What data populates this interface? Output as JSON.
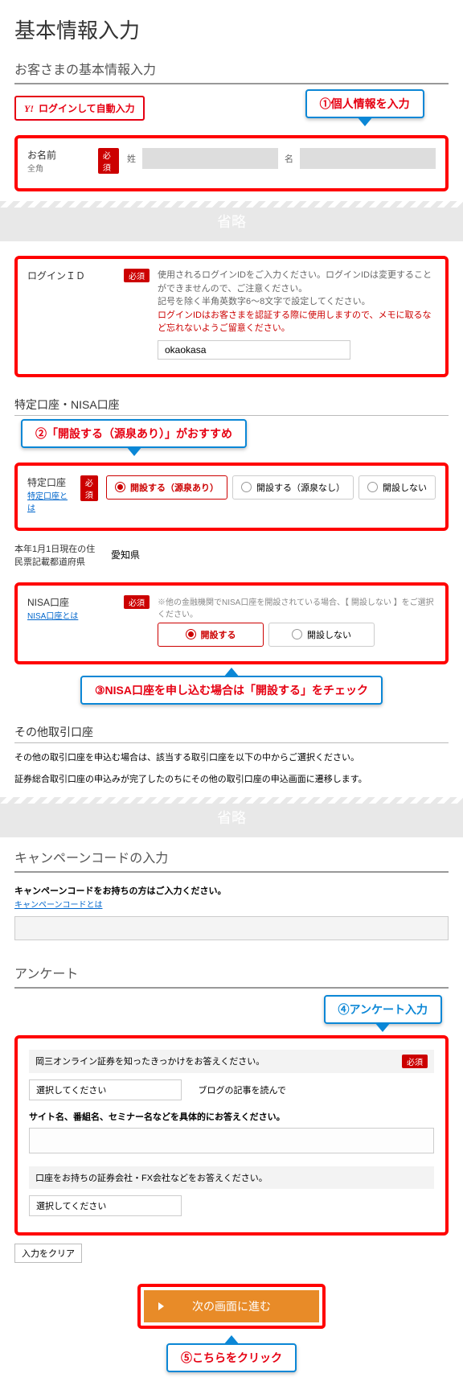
{
  "page_title": "基本情報入力",
  "section_basic": "お客さまの基本情報入力",
  "yahoo_btn": "ログインして自動入力",
  "callouts": {
    "c1": "①個人情報を入力",
    "c2": "②「開設する（源泉あり）」がおすすめ",
    "c3": "③NISA口座を申し込む場合は「開設する」をチェック",
    "c4": "④アンケート入力",
    "c5": "⑤こちらをクリック"
  },
  "required": "必須",
  "name": {
    "label": "お名前",
    "sub": "全角",
    "sei": "姓",
    "mei": "名"
  },
  "omitted": "省略",
  "login_id": {
    "label": "ログインＩＤ",
    "desc1": "使用されるログインIDをご入力ください。ログインIDは変更することができませんので、ご注意ください。",
    "desc2": "記号を除く半角英数字6～8文字で設定してください。",
    "warn": "ログインIDはお客さまを認証する際に使用しますので、メモに取るなど忘れないようご留意ください。",
    "value": "okaokasa"
  },
  "section_tokutei": "特定口座・NISA口座",
  "tokutei": {
    "label": "特定口座",
    "link": "特定口座とは",
    "opt1": "開設する（源泉あり）",
    "opt2": "開設する（源泉なし）",
    "opt3": "開設しない"
  },
  "pref": {
    "label": "本年1月1日現在の住民票記載都道府県",
    "value": "愛知県"
  },
  "nisa": {
    "label": "NISA口座",
    "link": "NISA口座とは",
    "note": "※他の金融機関でNISA口座を開設されている場合、【 開設しない 】をご選択ください。",
    "opt1": "開設する",
    "opt2": "開設しない"
  },
  "section_other": "その他取引口座",
  "other_txt1": "その他の取引口座を申込む場合は、該当する取引口座を以下の中からご選択ください。",
  "other_txt2": "証券総合取引口座の申込みが完了したのちにその他の取引口座の申込画面に遷移します。",
  "section_campaign": "キャンペーンコードの入力",
  "campaign_txt": "キャンペーンコードをお持ちの方はご入力ください。",
  "campaign_link": "キャンペーンコードとは",
  "section_survey": "アンケート",
  "survey": {
    "q1": "岡三オンライン証券を知ったきっかけをお答えください。",
    "select_placeholder": "選択してください",
    "inline": "ブログの記事を読んで",
    "q2": "サイト名、番組名、セミナー名などを具体的にお答えください。",
    "q3": "口座をお持ちの証券会社・FX会社などをお答えください。"
  },
  "clear_btn": "入力をクリア",
  "next_btn": "次の画面に進む"
}
